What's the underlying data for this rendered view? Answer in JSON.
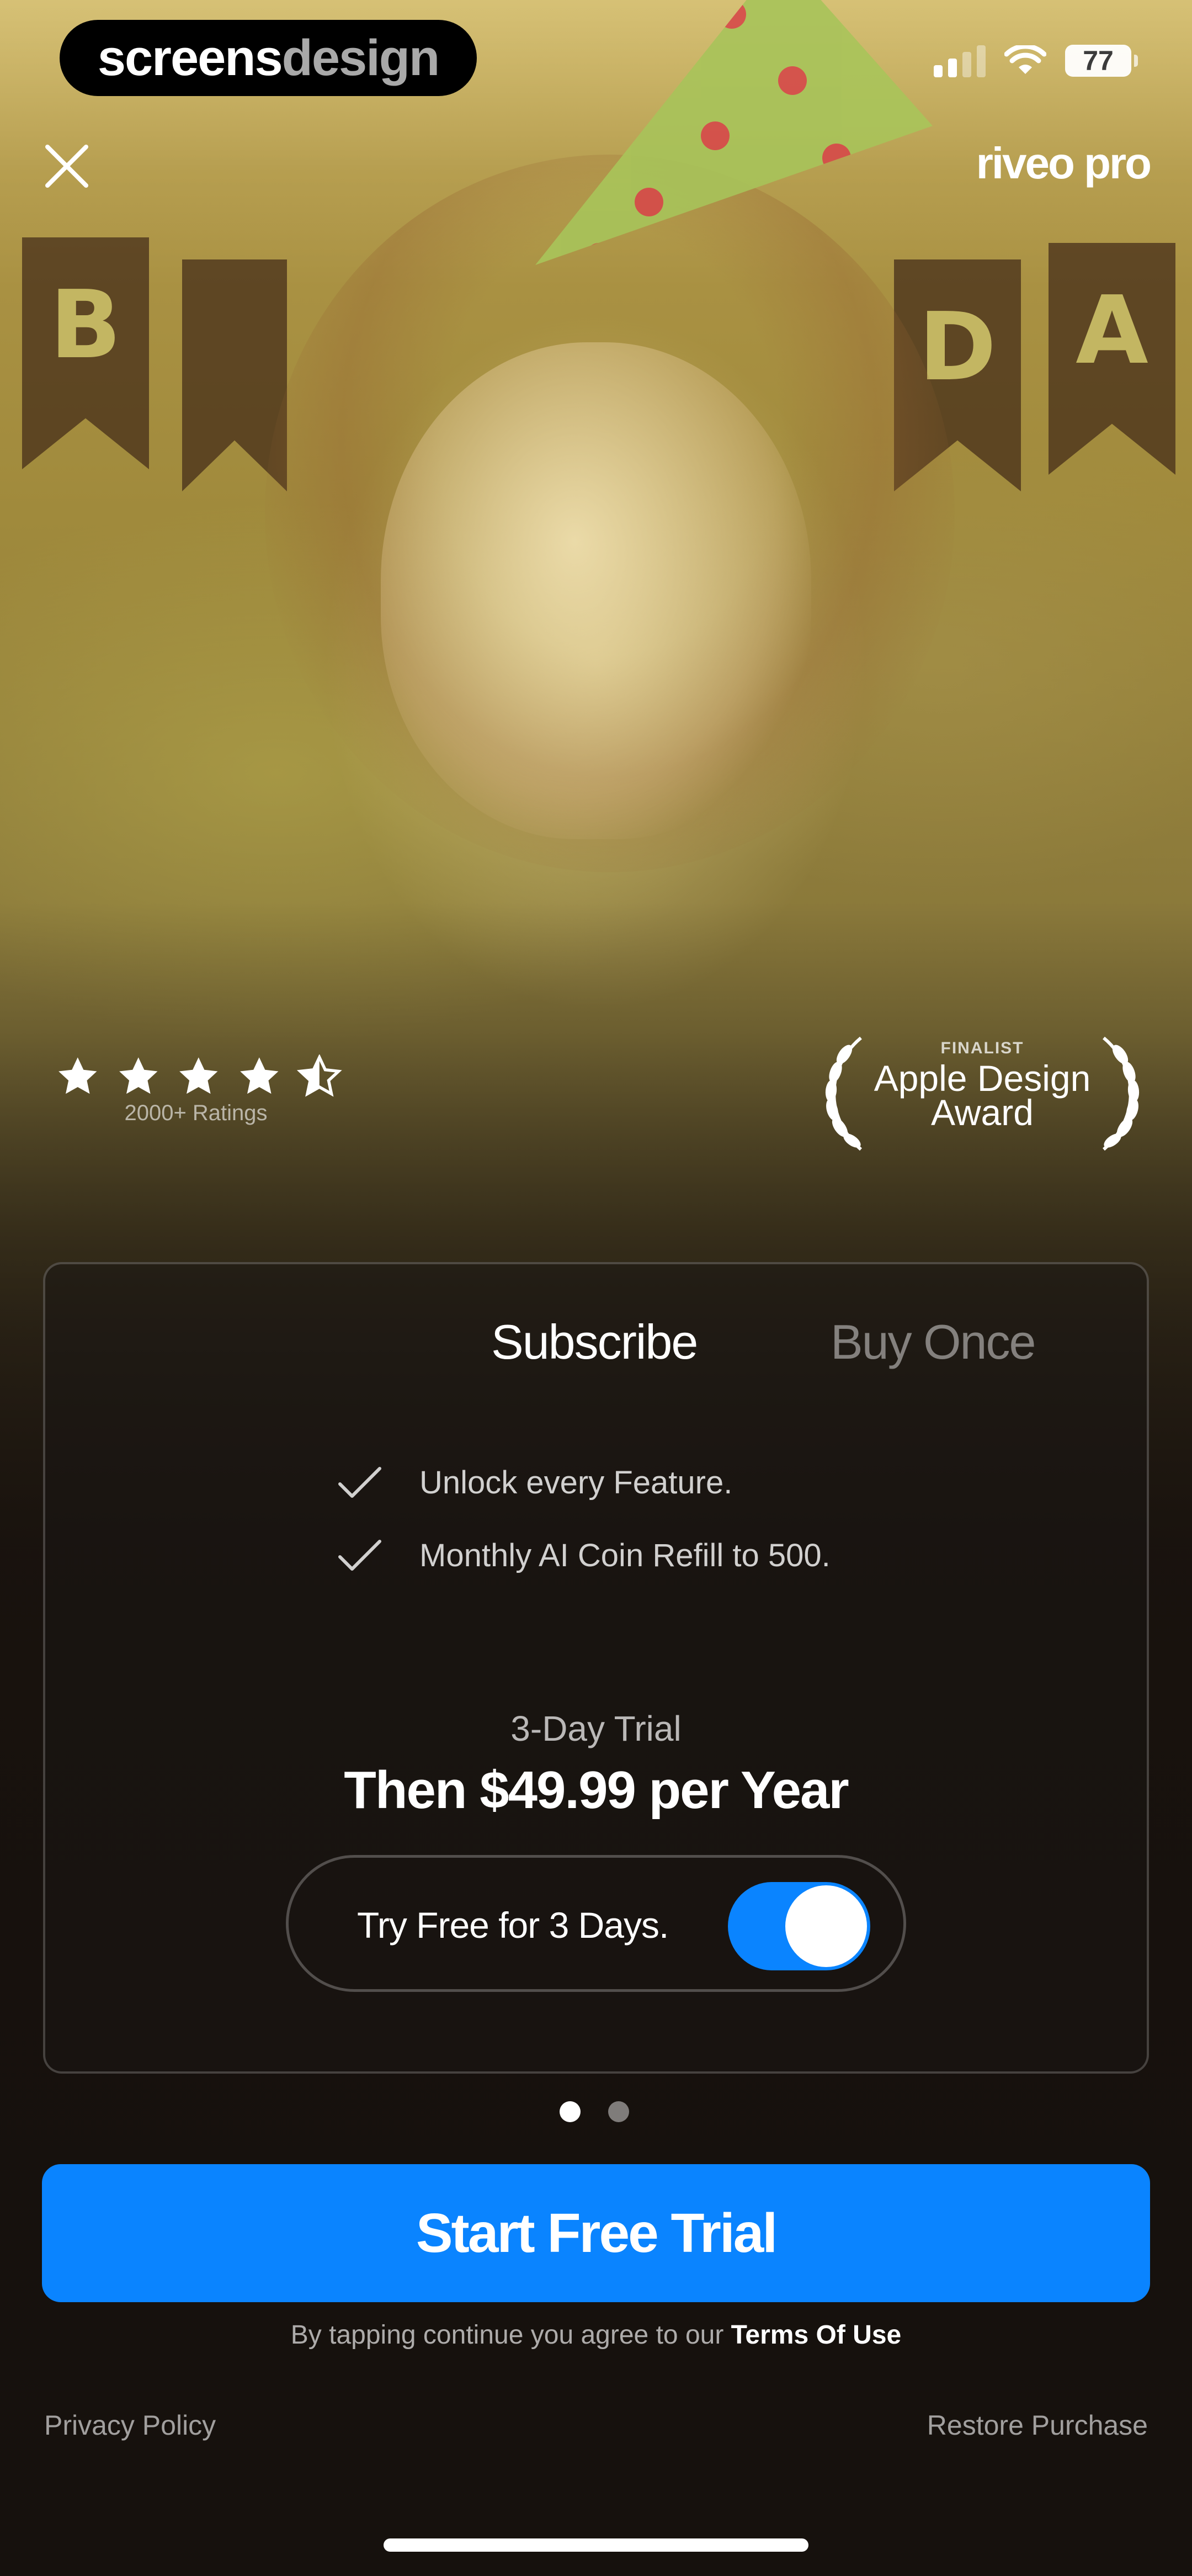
{
  "brand_overlay": {
    "part1": "screens",
    "part2": "design"
  },
  "status_bar": {
    "battery": "77"
  },
  "header": {
    "app_logo": "riveo pro"
  },
  "background": {
    "banner_letters": [
      "B",
      "",
      "D",
      "A"
    ]
  },
  "ratings": {
    "stars": 4.5,
    "count_label": "2000+ Ratings"
  },
  "award": {
    "line1": "FINALIST",
    "line2": "Apple Design",
    "line3": "Award"
  },
  "tabs": [
    {
      "label": "Subscribe",
      "selected": true
    },
    {
      "label": "Buy Once",
      "selected": false
    }
  ],
  "features": [
    {
      "label": "Unlock every Feature."
    },
    {
      "label": "Monthly AI Coin Refill to 500."
    }
  ],
  "plan": {
    "trial_label": "3-Day Trial",
    "price_line": "Then $49.99 per Year",
    "toggle_label": "Try Free for 3 Days.",
    "toggle_on": true
  },
  "pager": {
    "total": 2,
    "active": 1
  },
  "cta": {
    "label": "Start Free Trial"
  },
  "legal": {
    "prefix": "By tapping continue you agree to our",
    "terms_link": "Terms Of Use"
  },
  "footer": {
    "privacy": "Privacy Policy",
    "restore": "Restore Purchase"
  },
  "colors": {
    "accent": "#0a84ff",
    "card_bg": "#19161400"
  }
}
